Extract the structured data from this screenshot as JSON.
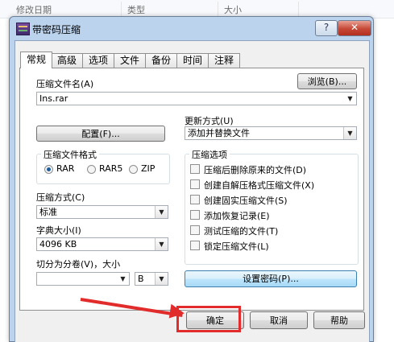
{
  "background": {
    "columns": [
      "修改日期",
      "类型",
      "大小"
    ]
  },
  "dialog": {
    "title": "带密码压缩",
    "help_label": "?",
    "close_label": "✕",
    "tabs": [
      {
        "label": "常规"
      },
      {
        "label": "高级"
      },
      {
        "label": "选项"
      },
      {
        "label": "文件"
      },
      {
        "label": "备份"
      },
      {
        "label": "时间"
      },
      {
        "label": "注释"
      }
    ],
    "archive_name_label": "压缩文件名(A)",
    "archive_name_value": "Ins.rar",
    "browse_label": "浏览(B)...",
    "update_mode_label": "更新方式(U)",
    "update_mode_value": "添加并替换文件",
    "profile_label": "配置(F)...",
    "format_group_label": "压缩文件格式",
    "formats": [
      {
        "label": "RAR",
        "checked": true
      },
      {
        "label": "RAR5",
        "checked": false
      },
      {
        "label": "ZIP",
        "checked": false
      }
    ],
    "method_label": "压缩方式(C)",
    "method_value": "标准",
    "dict_label": "字典大小(I)",
    "dict_value": "4096 KB",
    "split_label": "切分为分卷(V)，大小",
    "split_value": "",
    "split_unit_value": "B",
    "options_group_label": "压缩选项",
    "options": [
      {
        "label": "压缩后删除原来的文件(D)"
      },
      {
        "label": "创建自解压格式压缩文件(X)"
      },
      {
        "label": "创建固实压缩文件(S)"
      },
      {
        "label": "添加恢复记录(E)"
      },
      {
        "label": "测试压缩的文件(T)"
      },
      {
        "label": "锁定压缩文件(L)"
      }
    ],
    "set_password_label": "设置密码(P)...",
    "ok_label": "确定",
    "cancel_label": "取消",
    "help_button_label": "帮助"
  },
  "colors": {
    "annotation": "#e22b2b",
    "dialog_frame": "#bcd3ee",
    "focus_button": "#a7d9f5"
  }
}
